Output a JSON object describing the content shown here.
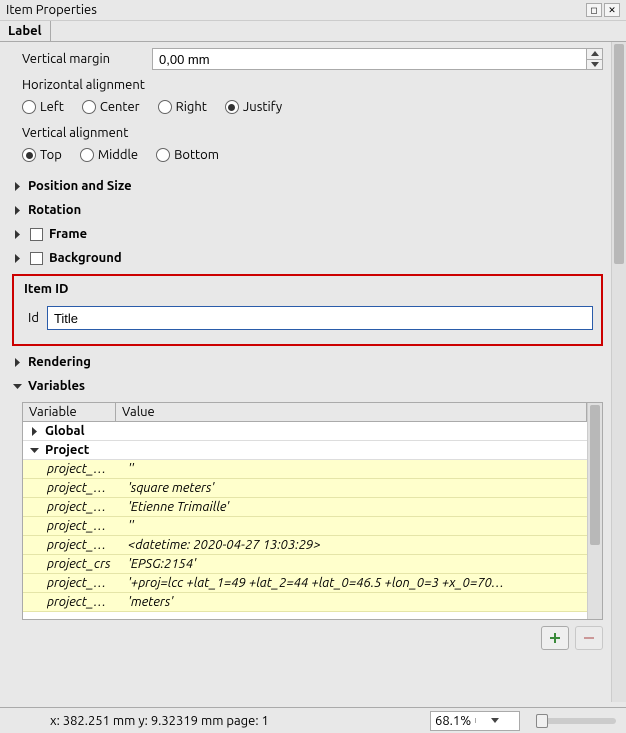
{
  "window": {
    "title": "Item Properties"
  },
  "tab": {
    "label": "Label"
  },
  "margin": {
    "vertical_label": "Vertical margin",
    "vertical_value": "0,00 mm"
  },
  "alignment": {
    "horizontal_label": "Horizontal alignment",
    "h_options": {
      "left": "Left",
      "center": "Center",
      "right": "Right",
      "justify": "Justify"
    },
    "h_selected": "justify",
    "vertical_label": "Vertical alignment",
    "v_options": {
      "top": "Top",
      "middle": "Middle",
      "bottom": "Bottom"
    },
    "v_selected": "top"
  },
  "sections": {
    "position": "Position and Size",
    "rotation": "Rotation",
    "frame": "Frame",
    "background": "Background",
    "item_id": "Item ID",
    "rendering": "Rendering",
    "variables": "Variables"
  },
  "item_id": {
    "label": "Id",
    "value": "Title"
  },
  "variables": {
    "columns": {
      "variable": "Variable",
      "value": "Value"
    },
    "groups": {
      "global": "Global",
      "project": "Project"
    },
    "project_rows": [
      {
        "name": "project_…",
        "value": "''"
      },
      {
        "name": "project_…",
        "value": "'square meters'"
      },
      {
        "name": "project_…",
        "value": "'Etienne Trimaille'"
      },
      {
        "name": "project_…",
        "value": "''"
      },
      {
        "name": "project_…",
        "value": "<datetime: 2020-04-27 13:03:29>"
      },
      {
        "name": "project_crs",
        "value": "'EPSG:2154'"
      },
      {
        "name": "project_…",
        "value": "'+proj=lcc +lat_1=49 +lat_2=44 +lat_0=46.5 +lon_0=3 +x_0=70…"
      },
      {
        "name": "project_…",
        "value": "'meters'"
      }
    ]
  },
  "statusbar": {
    "coords": "x: 382.251 mm   y: 9.32319 mm   page: 1",
    "zoom": "68.1%"
  }
}
